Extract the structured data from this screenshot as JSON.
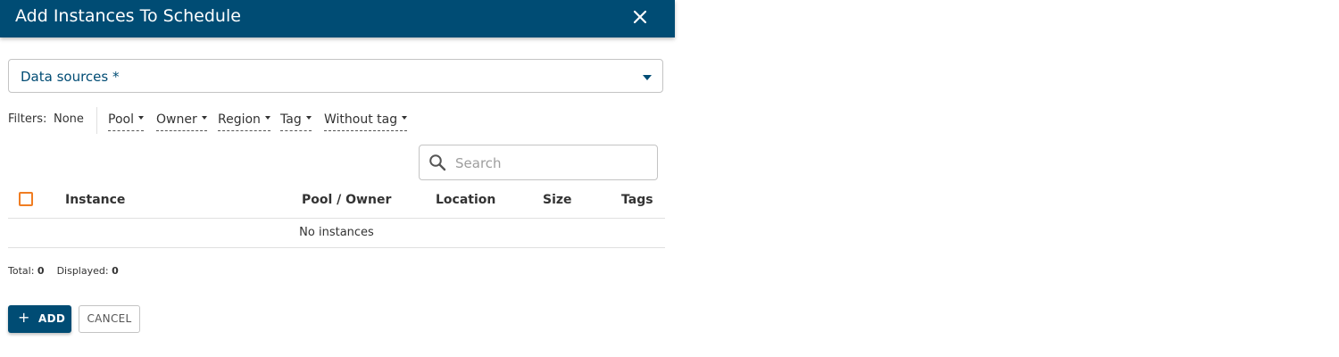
{
  "dialog": {
    "title": "Add Instances To Schedule"
  },
  "data_sources": {
    "label": "Data sources *"
  },
  "filters": {
    "label": "Filters:",
    "active": "None",
    "chips": [
      "Pool",
      "Owner",
      "Region",
      "Tag",
      "Without tag"
    ]
  },
  "search": {
    "placeholder": "Search",
    "value": ""
  },
  "table": {
    "columns": [
      "Instance",
      "Pool / Owner",
      "Location",
      "Size",
      "Tags"
    ],
    "empty_message": "No instances"
  },
  "summary": {
    "total_label": "Total:",
    "total_value": "0",
    "displayed_label": "Displayed:",
    "displayed_value": "0"
  },
  "actions": {
    "add_label": "ADD",
    "add_icon": "plus-icon",
    "cancel_label": "CANCEL"
  },
  "colors": {
    "header": "#004c74",
    "primary": "#004c74",
    "checkbox_accent": "#f07d22"
  }
}
